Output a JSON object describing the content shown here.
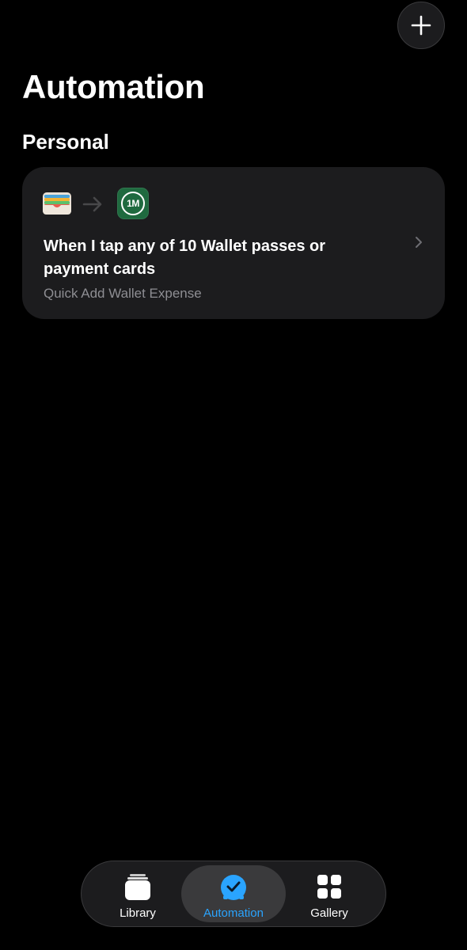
{
  "page": {
    "title": "Automation",
    "section_title": "Personal"
  },
  "header": {
    "add_icon": "plus-icon"
  },
  "automation_card": {
    "trigger_icon": "wallet-icon",
    "arrow_icon": "arrow-right-icon",
    "app_icon_text": "1M",
    "title": "When I tap any of 10 Wallet passes or payment cards",
    "subtitle": "Quick Add Wallet Expense"
  },
  "tabbar": {
    "tabs": [
      {
        "label": "Library",
        "icon": "library-icon",
        "selected": false
      },
      {
        "label": "Automation",
        "icon": "automation-clock-icon",
        "selected": true
      },
      {
        "label": "Gallery",
        "icon": "gallery-grid-icon",
        "selected": false
      }
    ]
  },
  "colors": {
    "accent": "#2aa4ff",
    "app_icon_bg": "#1f6a3f",
    "card_bg": "#1c1c1e"
  }
}
